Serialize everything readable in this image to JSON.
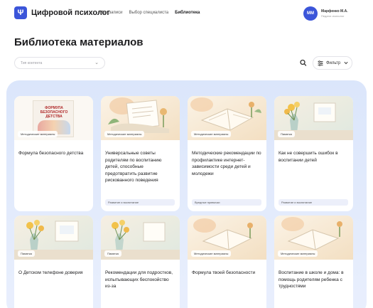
{
  "header": {
    "app_name": "Цифровой психолог",
    "nav": [
      {
        "label": "Мои записи"
      },
      {
        "label": "Выбор специалиста"
      },
      {
        "label": "Библиотека"
      }
    ],
    "active_nav": "Библиотека",
    "user": {
      "initials": "ММ",
      "name": "Марфенко М.А.",
      "role": "Педагог-психолог"
    }
  },
  "page": {
    "title": "Библиотека материалов"
  },
  "filters": {
    "content_type_placeholder": "Тип контента",
    "filter_label": "Фильтр"
  },
  "colors": {
    "accent": "#3b55d9",
    "panel": "#dbe6fb"
  },
  "cards": [
    {
      "badge": "Методические материалы",
      "title": "Формула безопасного детства",
      "tag": "",
      "image": "book-cover",
      "book_title": "ФОРМУЛА БЕЗОПАСНОГО ДЕТСТВА"
    },
    {
      "badge": "Методические материалы",
      "title": "Универсальные советы родителям по воспитанию детей, способные предотвратить развитие рискованного поведения",
      "tag": "Развитие и воспитание",
      "image": "papers-flowers"
    },
    {
      "badge": "Методические материалы",
      "title": "Методические рекомендации по профилактике интернет-зависимости среди детей и молодежи",
      "tag": "Вредные привычки",
      "image": "papers-flowers"
    },
    {
      "badge": "Памятка",
      "title": "Как не совершить ошибок в воспитании детей",
      "tag": "Развитие и воспитание",
      "image": "vase-flowers"
    },
    {
      "badge": "Памятка",
      "title": "О Детском телефоне доверия",
      "tag": "",
      "image": "vase-flowers"
    },
    {
      "badge": "Памятка",
      "title": "Рекомендации для подростков, испытывающих беспокойство из-за",
      "tag": "",
      "image": "vase-flowers"
    },
    {
      "badge": "Методические материалы",
      "title": "Формула твоей безопасности",
      "tag": "",
      "image": "papers-flowers"
    },
    {
      "badge": "Методические материалы",
      "title": "Воспитание в школе и дома: в помощь родителям ребенка с трудностями",
      "tag": "",
      "image": "papers-flowers"
    }
  ]
}
